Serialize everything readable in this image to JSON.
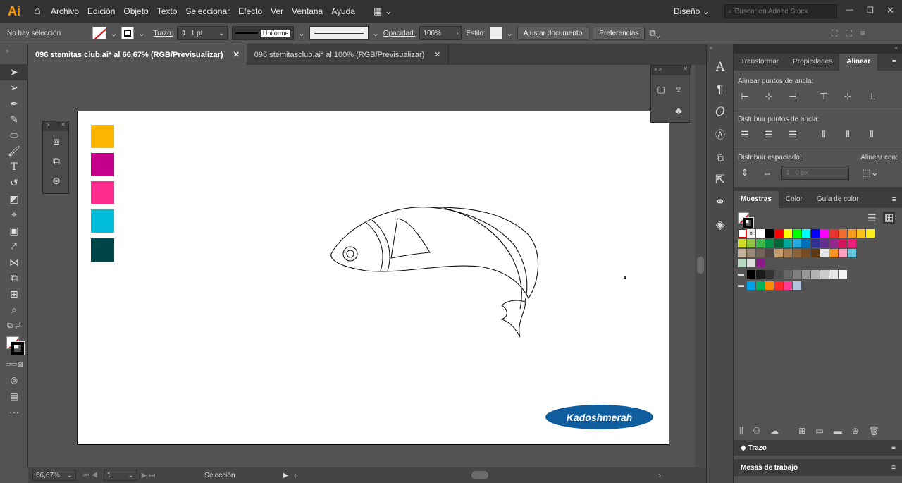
{
  "app": {
    "logo": "Ai"
  },
  "menu": [
    "Archivo",
    "Edición",
    "Objeto",
    "Texto",
    "Seleccionar",
    "Efecto",
    "Ver",
    "Ventana",
    "Ayuda"
  ],
  "workspace": {
    "label": "Diseño",
    "search_placeholder": "Buscar en Adobe Stock"
  },
  "control": {
    "selection": "No hay selección",
    "stroke_label": "Trazo:",
    "stroke_value": "1 pt",
    "profile": "Uniforme",
    "opacity_label": "Opacidad:",
    "opacity_value": "100%",
    "style_label": "Estilo:",
    "adjust_button": "Ajustar documento",
    "prefs_button": "Preferencias"
  },
  "tabs": [
    {
      "label": "096 stemitas club.ai* al 66,67% (RGB/Previsualizar)"
    },
    {
      "label": "096 stemitasclub.ai* al 100% (RGB/Previsualizar)"
    }
  ],
  "artboard_swatches": [
    "#FBB700",
    "#C4008A",
    "#FF2C8F",
    "#00BCD8",
    "#004548"
  ],
  "watermark": "Kadoshmerah",
  "status": {
    "zoom": "66,67%",
    "page": "1",
    "tool": "Selección"
  },
  "panel": {
    "tabs1": [
      "Transformar",
      "Propiedades",
      "Alinear"
    ],
    "align_anchor": "Alinear puntos de ancla:",
    "distribute_anchor": "Distribuir puntos de ancla:",
    "distribute_spacing": "Distribuir espaciado:",
    "align_to": "Alinear con:",
    "spacing_value": "0 px",
    "tabs2": [
      "Muestras",
      "Color",
      "Guía de color"
    ],
    "trazo": "Trazo",
    "mesas": "Mesas de trabajo"
  },
  "swatch_rows": [
    [
      "#ffffff",
      "#000000",
      "#ff0000",
      "#ffff00",
      "#00ff00",
      "#00ffff",
      "#0000ff",
      "#ff00ff",
      "#e9332d",
      "#ef6c2f",
      "#f39c1f",
      "#f7c31b",
      "#f9ee1b"
    ],
    [
      "#cfdd28",
      "#8ec63f",
      "#39b54a",
      "#009245",
      "#006837",
      "#00a99d",
      "#29abe2",
      "#0071bc",
      "#2e3192",
      "#662d91",
      "#93278f",
      "#d4145a",
      "#ed1e79"
    ],
    [
      "#c7b299",
      "#998675",
      "#736357",
      "#534741",
      "#c69c6d",
      "#a67c52",
      "#8c6239",
      "#754c24",
      "#603813",
      "#e6e6e6",
      "#f7931e",
      "#ff9fc1",
      "#62c4df"
    ]
  ],
  "swatch_grays": [
    "#000000",
    "#1a1a1a",
    "#333333",
    "#4d4d4d",
    "#666666",
    "#808080",
    "#999999",
    "#b3b3b3",
    "#cccccc",
    "#e6e6e6",
    "#f2f2f2"
  ],
  "swatch_group": [
    "#00a0e9",
    "#00b05a",
    "#ff8c00",
    "#ff2a2a",
    "#ff3d93",
    "#b0c4de"
  ]
}
